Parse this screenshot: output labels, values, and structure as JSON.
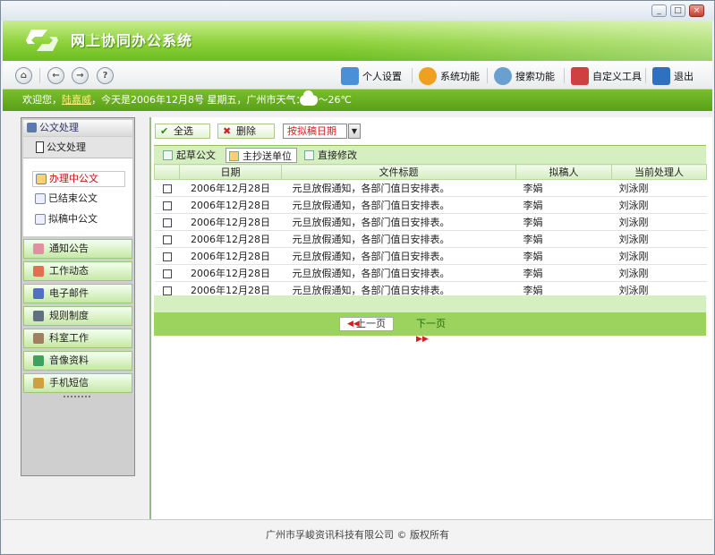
{
  "window": {
    "minimize": "_",
    "maximize": "□",
    "close": "×"
  },
  "banner": {
    "app_title": "网上协同办公系统"
  },
  "toolbar": {
    "nav": {
      "home": "⌂",
      "back": "←",
      "forward": "→",
      "help": "?"
    },
    "items": [
      {
        "label": "个人设置",
        "icon": "personal-settings-icon",
        "color": "#4a90d9"
      },
      {
        "label": "系统功能",
        "icon": "gear-icon",
        "color": "#f0a020"
      },
      {
        "label": "搜索功能",
        "icon": "magnifier-icon",
        "color": "#6aa0d0"
      },
      {
        "label": "自定义工具",
        "icon": "custom-tools-icon",
        "color": "#d04040"
      },
      {
        "label": "退出",
        "icon": "exit-icon",
        "color": "#3070c0"
      }
    ]
  },
  "info_bar": {
    "greeting": "欢迎您，",
    "user": "陆嘉威",
    "text": "，今天是2006年12月8号  星期五，广州市天气：20～26℃",
    "weather_icon": "cloud-icon"
  },
  "sidebar": {
    "header": "公文处理",
    "section": "公文处理",
    "submenu": [
      "办理中公文",
      "已结束公文",
      "拟稿中公文"
    ],
    "modules": [
      "通知公告",
      "工作动态",
      "电子邮件",
      "规则制度",
      "科室工作",
      "音像资料",
      "手机短信"
    ]
  },
  "actions": {
    "select_all": "全选",
    "delete": "删除",
    "sort_value": "按拟稿日期",
    "sort_arrow": "▼"
  },
  "tabs": [
    "起草公文",
    "主抄送单位",
    "直接修改"
  ],
  "table": {
    "columns": [
      "日期",
      "文件标题",
      "拟稿人",
      "当前处理人"
    ],
    "rows": [
      [
        "2006年12月28日",
        "元旦放假通知，各部门值日安排表。",
        "李娟",
        "刘泳刚"
      ],
      [
        "2006年12月28日",
        "元旦放假通知，各部门值日安排表。",
        "李娟",
        "刘泳刚"
      ],
      [
        "2006年12月28日",
        "元旦放假通知，各部门值日安排表。",
        "李娟",
        "刘泳刚"
      ],
      [
        "2006年12月28日",
        "元旦放假通知，各部门值日安排表。",
        "李娟",
        "刘泳刚"
      ],
      [
        "2006年12月28日",
        "元旦放假通知，各部门值日安排表。",
        "李娟",
        "刘泳刚"
      ],
      [
        "2006年12月28日",
        "元旦放假通知，各部门值日安排表。",
        "李娟",
        "刘泳刚"
      ],
      [
        "2006年12月28日",
        "元旦放假通知，各部门值日安排表。",
        "李娟",
        "刘泳刚"
      ]
    ]
  },
  "pager": {
    "prev": "上一页",
    "next": "下一页"
  },
  "footer": {
    "copyright": "广州市孚峻资讯科技有限公司 © 版权所有"
  }
}
